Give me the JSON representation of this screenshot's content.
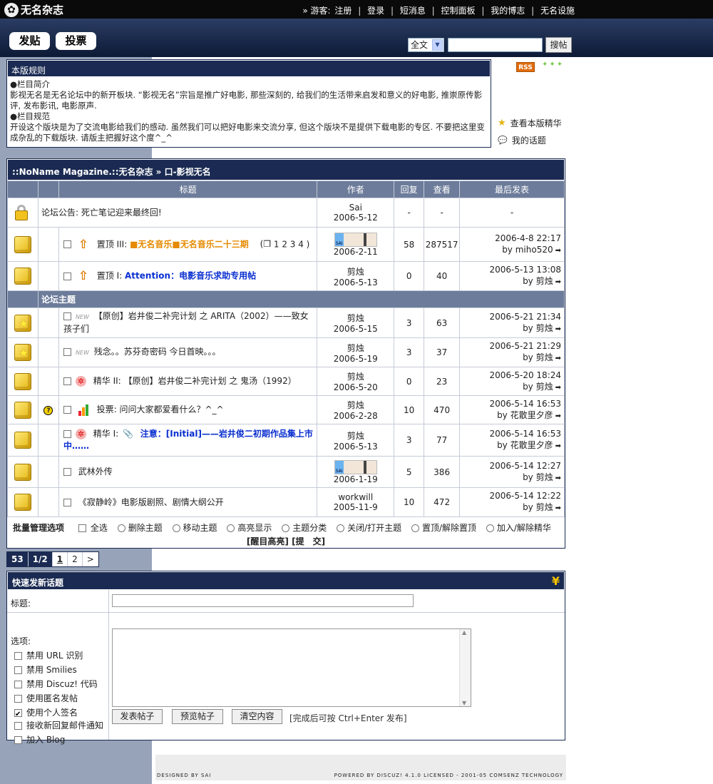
{
  "brand": {
    "logo_text": "无名杂志"
  },
  "topnav": {
    "guest_prefix": "» 游客:",
    "register": "注册",
    "login": "登录",
    "pm": "短消息",
    "control_panel": "控制面板",
    "my_blog": "我的博志",
    "nameless_settings": "无名设施"
  },
  "header": {
    "post_button": "发贴",
    "poll_button": "投票",
    "search_scope": "全文",
    "search_value": "",
    "search_button": "搜帖"
  },
  "rules": {
    "title": "本版规则",
    "h1": "●栏目简介",
    "p1": "影视无名是无名论坛中的新开板块. “影视无名”宗旨是推广好电影, 那些深刻的, 给我们的生活带来启发和意义的好电影, 推崇原传影评, 发布影讯, 电影原声.",
    "h2": "●栏目规范",
    "p2": "开设这个版块是为了交流电影给我们的感动. 虽然我们可以把好电影来交流分享, 但这个版块不是提供下载电影的专区. 不要把这里变成杂乱的下载版块. 请版主把握好这个度^_^"
  },
  "side": {
    "rss": "RSS",
    "view_digest": "查看本版精华",
    "my_topics": "我的话题"
  },
  "forum": {
    "breadcrumb": "::NoName Magazine.::无名杂志 » 口-影视无名",
    "headers": {
      "title": "标题",
      "author": "作者",
      "replies": "回复",
      "views": "查看",
      "last_post": "最后发表"
    },
    "announcement": {
      "text": "论坛公告: 死亡笔记迎来最终回!",
      "author": "Sai",
      "date": "2006-5-12",
      "replies": "-",
      "views": "-",
      "last": "-"
    },
    "sticky": [
      {
        "prefix": "置顶 III:",
        "title": "■无名音乐■无名音乐二十三期",
        "pages": "1 2 3 4 )",
        "author_date": "2006-2-11",
        "replies": "58",
        "views": "287517",
        "last_time": "2006-4-8 22:17",
        "last_by": "by miho520"
      },
      {
        "prefix": "置顶 I:",
        "title": "Attention：电影音乐求助专用帖",
        "author": "剪烛",
        "author_date": "2006-5-13",
        "replies": "0",
        "views": "40",
        "last_time": "2006-5-13 13:08",
        "last_by": "by 剪烛"
      }
    ],
    "section_label": "论坛主题",
    "threads": [
      {
        "prefix": "",
        "title": "【原创】岩井俊二补完计划 之 ARITA（2002）——致女孩子们",
        "author": "剪烛",
        "date": "2006-5-15",
        "replies": "3",
        "views": "63",
        "last_time": "2006-5-21 21:34",
        "last_by": "by 剪烛"
      },
      {
        "prefix": "",
        "title": "残念。。苏芬奇密码 今日首映。。。",
        "author": "剪烛",
        "date": "2006-5-19",
        "replies": "3",
        "views": "37",
        "last_time": "2006-5-21 21:29",
        "last_by": "by 剪烛"
      },
      {
        "prefix": "精华 II:",
        "title": "【原创】岩井俊二补完计划 之 鬼汤（1992）",
        "author": "剪烛",
        "date": "2006-5-20",
        "replies": "0",
        "views": "23",
        "last_time": "2006-5-20 18:24",
        "last_by": "by 剪烛"
      },
      {
        "prefix": "投票:",
        "title": "问问大家都爱看什么？^_^",
        "author": "剪烛",
        "date": "2006-2-28",
        "replies": "10",
        "views": "470",
        "last_time": "2006-5-14 16:53",
        "last_by": "by 花散里夕彦"
      },
      {
        "prefix": "精华 I:",
        "title": "注意：[Initial]——岩井俊二初期作品集上市中……",
        "author": "剪烛",
        "date": "2006-5-13",
        "replies": "3",
        "views": "77",
        "last_time": "2006-5-14 16:53",
        "last_by": "by 花散里夕彦"
      },
      {
        "prefix": "",
        "title": "武林外传",
        "author": "",
        "date": "2006-1-19",
        "replies": "5",
        "views": "386",
        "last_time": "2006-5-14 12:27",
        "last_by": "by 剪烛"
      },
      {
        "prefix": "",
        "title": "《寂静岭》电影版剧照、剧情大纲公开",
        "author": "workwill",
        "date": "2005-11-9",
        "replies": "10",
        "views": "472",
        "last_time": "2006-5-14 12:22",
        "last_by": "by 剪烛"
      }
    ],
    "batch": {
      "label": "批量管理选项",
      "select_all": "全选",
      "delete": "删除主题",
      "move": "移动主题",
      "highlight": "高亮显示",
      "classify": "主题分类",
      "close_open": "关闭/打开主题",
      "sticky": "置顶/解除置顶",
      "digest": "加入/解除精华",
      "bump": "[醒目高亮]",
      "submit": "[提　交]"
    }
  },
  "pagination": {
    "total": "53",
    "pos": "1/2",
    "p1": "1",
    "p2": "2",
    "next": ">"
  },
  "quick": {
    "title": "快速发新话题",
    "subject_label": "标题:",
    "options_label": "选项:",
    "opt1": "禁用 URL 识别",
    "opt2": "禁用 Smilies",
    "opt3": "禁用 Discuz! 代码",
    "opt4": "使用匿名发帖",
    "opt5": "使用个人签名",
    "opt6": "接收新回复邮件通知",
    "opt7": "加入 Blog",
    "submit": "发表帖子",
    "preview": "预览帖子",
    "clear": "清空内容",
    "hint": "[完成后可按 Ctrl+Enter 发布]"
  },
  "footer": {
    "left": "DESIGNED BY SAI",
    "right": "POWERED BY DISCUZ! 4.1.0 LICENSED - 2001-05 COMSENZ TECHNOLOGY"
  }
}
